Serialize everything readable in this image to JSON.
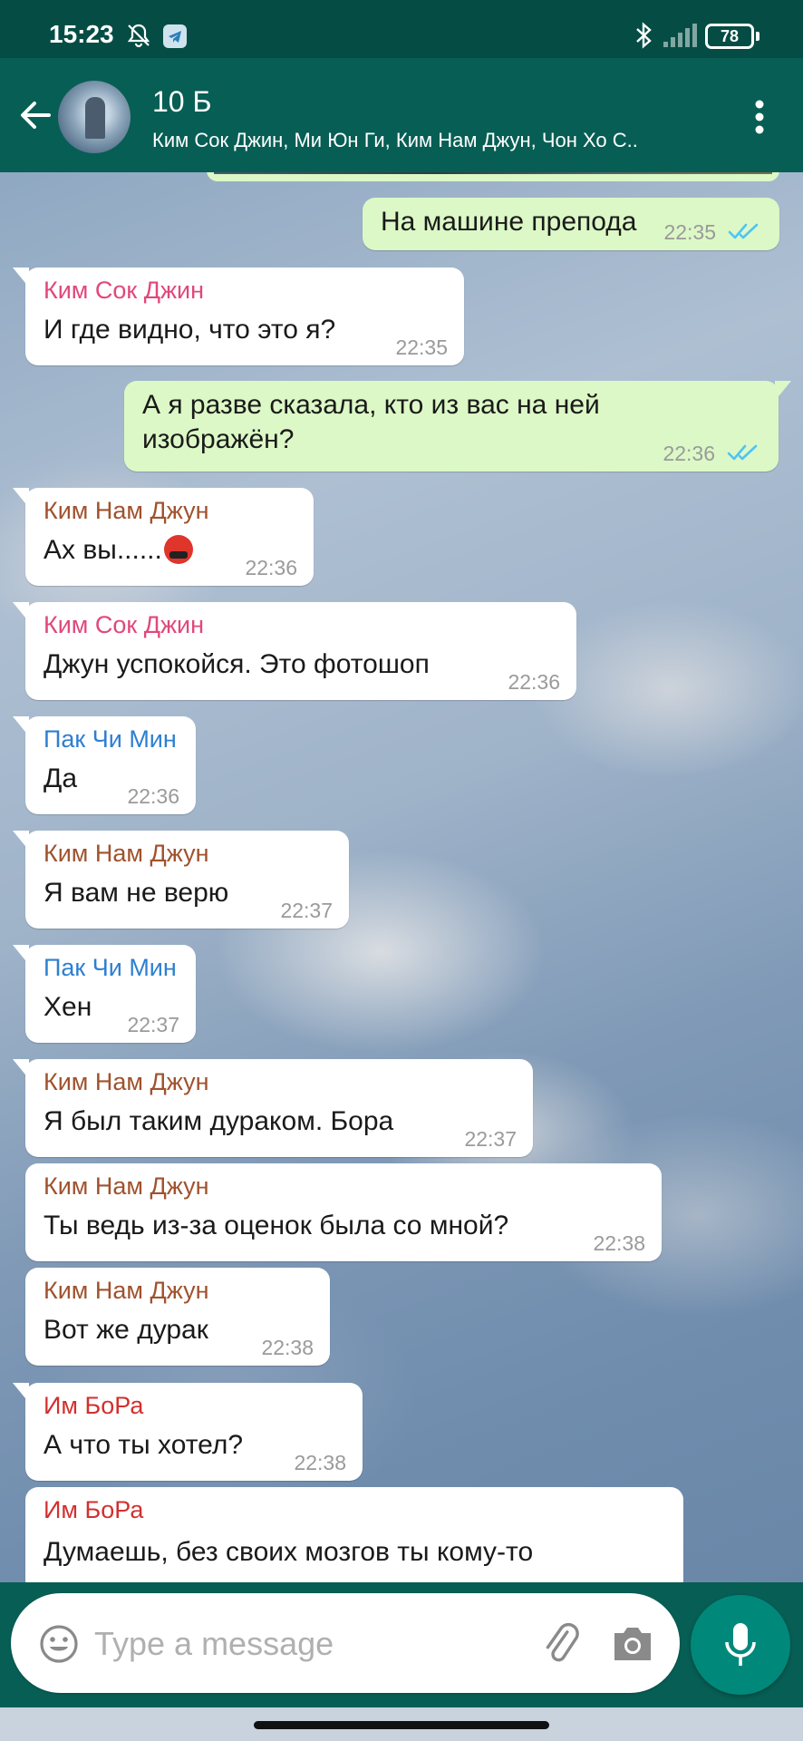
{
  "status_bar": {
    "time": "15:23",
    "battery": "78",
    "icons": [
      "bell-muted-icon",
      "telegram-icon",
      "bluetooth-icon",
      "signal-icon",
      "battery-icon"
    ]
  },
  "header": {
    "title": "10 Б",
    "subtitle": "Ким Сок Джин, Ми Юн Ги, Ким Нам Джун, Чон Хо С..",
    "icons": [
      "back-arrow-icon",
      "group-avatar",
      "more-vert-icon"
    ]
  },
  "colors": {
    "header_bg": "#075e54",
    "status_bg": "#054d44",
    "outgoing_bubble": "#dcf8c6",
    "incoming_bubble": "#ffffff",
    "read_check": "#4fc3f7",
    "mic_button": "#00897b",
    "sender_jin": "#e0487a",
    "sender_namjoon": "#a0522d",
    "sender_jimin": "#2e7fd1",
    "sender_bora": "#d32f2f"
  },
  "messages": [
    {
      "direction": "out",
      "text": "На машине препода",
      "time": "22:35",
      "read": true
    },
    {
      "direction": "in",
      "sender": "Ким Сок Джин",
      "text": "И где видно, что это я?",
      "time": "22:35"
    },
    {
      "direction": "out",
      "text_line1": "А я разве сказала, кто из вас на ней",
      "text_line2": "изображён?",
      "time": "22:36",
      "read": true
    },
    {
      "direction": "in",
      "sender": "Ким Нам Джун",
      "text": "Ах вы......",
      "emoji": "angry-face-emoji",
      "time": "22:36"
    },
    {
      "direction": "in",
      "sender": "Ким Сок Джин",
      "text": "Джун успокойся. Это фотошоп",
      "time": "22:36"
    },
    {
      "direction": "in",
      "sender": "Пак Чи Мин",
      "text": "Да",
      "time": "22:36"
    },
    {
      "direction": "in",
      "sender": "Ким Нам Джун",
      "text": "Я вам не верю",
      "time": "22:37"
    },
    {
      "direction": "in",
      "sender": "Пак Чи Мин",
      "text": "Хен",
      "time": "22:37"
    },
    {
      "direction": "in",
      "sender": "Ким Нам Джун",
      "text": "Я был таким дураком. Бора",
      "time": "22:37"
    },
    {
      "direction": "in",
      "sender": "Ким Нам Джун",
      "text": "Ты ведь из-за оценок была со мной?",
      "time": "22:38"
    },
    {
      "direction": "in",
      "sender": "Ким Нам Джун",
      "text": "Вот же дурак",
      "time": "22:38"
    },
    {
      "direction": "in",
      "sender": "Им БоРа",
      "text": "А что ты хотел?",
      "time": "22:38"
    },
    {
      "direction": "in",
      "sender": "Им БоРа",
      "text": "Думаешь, без своих мозгов ты кому-то"
    }
  ],
  "composer": {
    "placeholder": "Type a message",
    "icons": [
      "emoji-icon",
      "attach-icon",
      "camera-icon",
      "mic-icon"
    ]
  }
}
